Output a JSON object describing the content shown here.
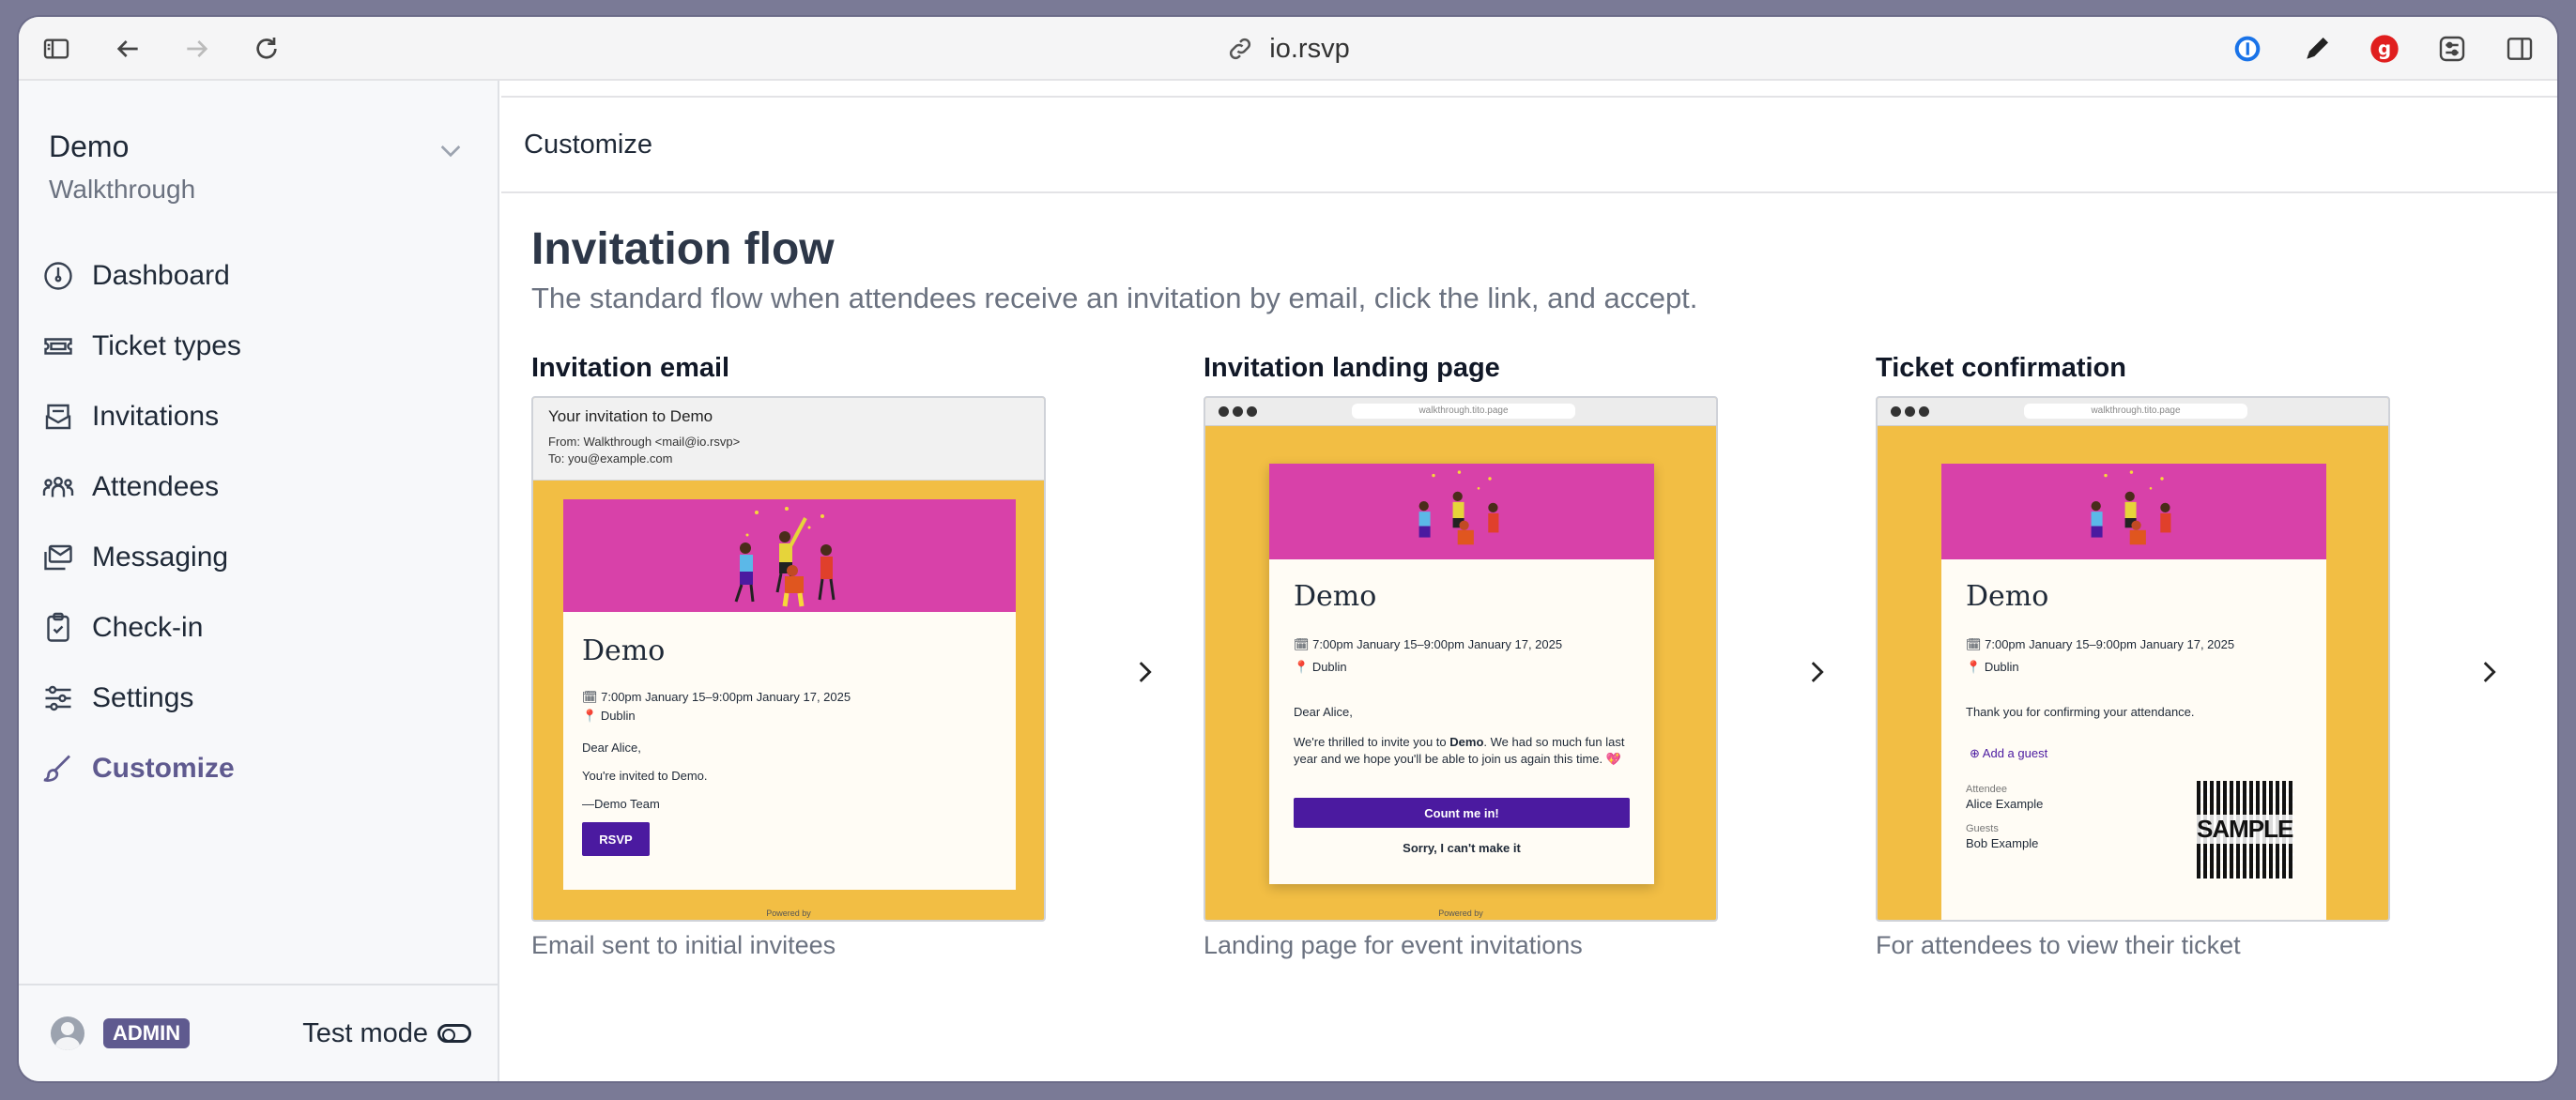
{
  "browser": {
    "url": "io.rsvp"
  },
  "sidebar": {
    "org_name": "Demo",
    "org_sub": "Walkthrough",
    "items": [
      {
        "label": "Dashboard"
      },
      {
        "label": "Ticket types"
      },
      {
        "label": "Invitations"
      },
      {
        "label": "Attendees"
      },
      {
        "label": "Messaging"
      },
      {
        "label": "Check-in"
      },
      {
        "label": "Settings"
      },
      {
        "label": "Customize"
      }
    ],
    "footer": {
      "badge": "ADMIN",
      "test_mode": "Test mode"
    }
  },
  "main": {
    "header": "Customize",
    "title": "Invitation flow",
    "subtitle": "The standard flow when attendees receive an invitation by email, click the link, and accept.",
    "cards": [
      {
        "title": "Invitation email",
        "caption": "Email sent to initial invitees",
        "subject": "Your invitation to Demo",
        "from": "From: Walkthrough <mail@io.rsvp>",
        "to": "To: you@example.com",
        "event": "Demo",
        "when": "7:00pm January 15–9:00pm January 17, 2025",
        "where": "Dublin",
        "greeting": "Dear Alice,",
        "body": "You're invited to Demo.",
        "signoff": "—Demo Team",
        "button": "RSVP",
        "powered": "Powered by"
      },
      {
        "title": "Invitation landing page",
        "caption": "Landing page for event invitations",
        "url": "walkthrough.tito.page",
        "event": "Demo",
        "when": "7:00pm January 15–9:00pm January 17, 2025",
        "where": "Dublin",
        "greeting": "Dear Alice,",
        "body_pre": "We're thrilled to invite you to ",
        "body_bold": "Demo",
        "body_post": ". We had so much fun last year and we hope you'll be able to join us again this time. 💖",
        "accept": "Count me in!",
        "decline": "Sorry, I can't make it",
        "powered": "Powered by"
      },
      {
        "title": "Ticket confirmation",
        "caption": "For attendees to view their ticket",
        "url": "walkthrough.tito.page",
        "event": "Demo",
        "when": "7:00pm January 15–9:00pm January 17, 2025",
        "where": "Dublin",
        "thanks": "Thank you for confirming your attendance.",
        "add_guest": "Add a guest",
        "attendee_label": "Attendee",
        "attendee": "Alice Example",
        "guests_label": "Guests",
        "guest": "Bob Example",
        "qr_label": "SAMPLE"
      }
    ]
  },
  "colors": {
    "accent": "#5f5a8f",
    "frame_bg": "#f2be44",
    "hero": "#d841a9",
    "button": "#4b1aa0"
  }
}
